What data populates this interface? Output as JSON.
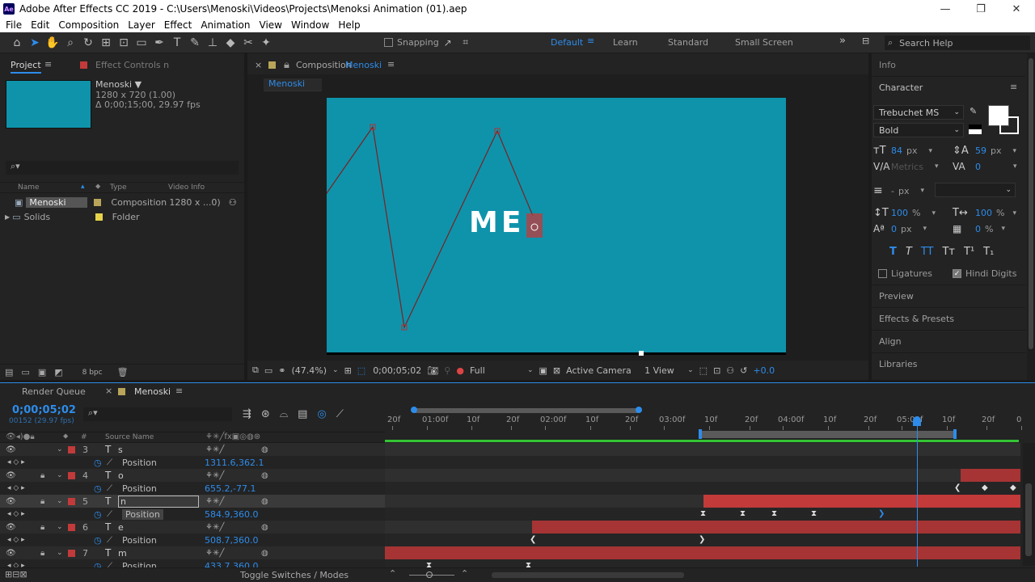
{
  "window": {
    "title": "Adobe After Effects CC 2019 - C:\\Users\\Menoski\\Videos\\Projects\\Menoksi Animation (01).aep",
    "logo_text": "Ae",
    "minimize": "—",
    "maximize": "❐",
    "close": "✕"
  },
  "menu": [
    "File",
    "Edit",
    "Composition",
    "Layer",
    "Effect",
    "Animation",
    "View",
    "Window",
    "Help"
  ],
  "toolbar": {
    "snapping_label": "Snapping",
    "workspaces": [
      "Default",
      "Learn",
      "Standard",
      "Small Screen"
    ],
    "active_workspace": "Default",
    "more": "»",
    "search_placeholder": "Search Help"
  },
  "project_panel": {
    "tab_project": "Project",
    "tab_effects": "Effect Controls n",
    "thumb_color": "#0f93ab",
    "selected_name": "Menoski ▼",
    "selected_dims": "1280 x 720 (1.00)",
    "selected_duration": "Δ 0;00;15;00, 29.97 fps",
    "search_glyph": "⌕▾",
    "columns": {
      "name": "Name",
      "type": "Type",
      "video_info": "Video Info"
    },
    "items": [
      {
        "name": "Menoski",
        "type": "Composition",
        "video_info": "1280 x ...0)",
        "color": "#b8a55a"
      },
      {
        "name": "Solids",
        "type": "Folder",
        "video_info": "",
        "color": "#e6d34a"
      }
    ],
    "bpc": "8 bpc"
  },
  "composition_panel": {
    "tab_prefix": "Composition",
    "comp_name": "Menoski",
    "subtab": "Menoski",
    "canvas_color": "#0f93ab",
    "canvas_text": "ME",
    "zoom": "(47.4%)",
    "timecode": "0;00;05;02",
    "resolution": "Full",
    "camera": "Active Camera",
    "views": "1 View",
    "exposure": "+0.0"
  },
  "right_panel": {
    "info": "Info",
    "character": "Character",
    "font_family": "Trebuchet MS",
    "font_style": "Bold",
    "font_size": "84",
    "leading": "59",
    "kerning": "Metrics",
    "tracking": "0",
    "stroke_width": "-",
    "vert_scale": "100",
    "horiz_scale": "100",
    "baseline": "0",
    "tsume": "0",
    "unit_px": "px",
    "unit_pct": "%",
    "style_buttons": [
      "T",
      "T",
      "TT",
      "Tт",
      "T¹",
      "T₁"
    ],
    "ligatures": "Ligatures",
    "hindi_digits": "Hindi Digits",
    "sections": [
      "Preview",
      "Effects & Presets",
      "Align",
      "Libraries"
    ]
  },
  "timeline": {
    "tab_render": "Render Queue",
    "tab_comp": "Menoski",
    "current_time": "0;00;05;02",
    "frame_info": "00152 (29.97 fps)",
    "source_name_header": "Source Name",
    "hash_header": "#",
    "ruler_labels": [
      "20f",
      "01:00f",
      "10f",
      "20f",
      "02:00f",
      "10f",
      "20f",
      "03:00f",
      "10f",
      "20f",
      "04:00f",
      "10f",
      "20f",
      "05:00f",
      "10f",
      "20f",
      "0"
    ],
    "layers": [
      {
        "num": "3",
        "name": "s",
        "prop": "Position",
        "value": "1311.6,362.1"
      },
      {
        "num": "4",
        "name": "o",
        "prop": "Position",
        "value": "655.2,-77.1"
      },
      {
        "num": "5",
        "name": "n",
        "prop": "Position",
        "value": "584.9,360.0"
      },
      {
        "num": "6",
        "name": "e",
        "prop": "Position",
        "value": "508.7,360.0"
      },
      {
        "num": "7",
        "name": "m",
        "prop": "Position",
        "value": "433.7,360.0"
      }
    ],
    "toggle_label": "Toggle Switches / Modes"
  }
}
